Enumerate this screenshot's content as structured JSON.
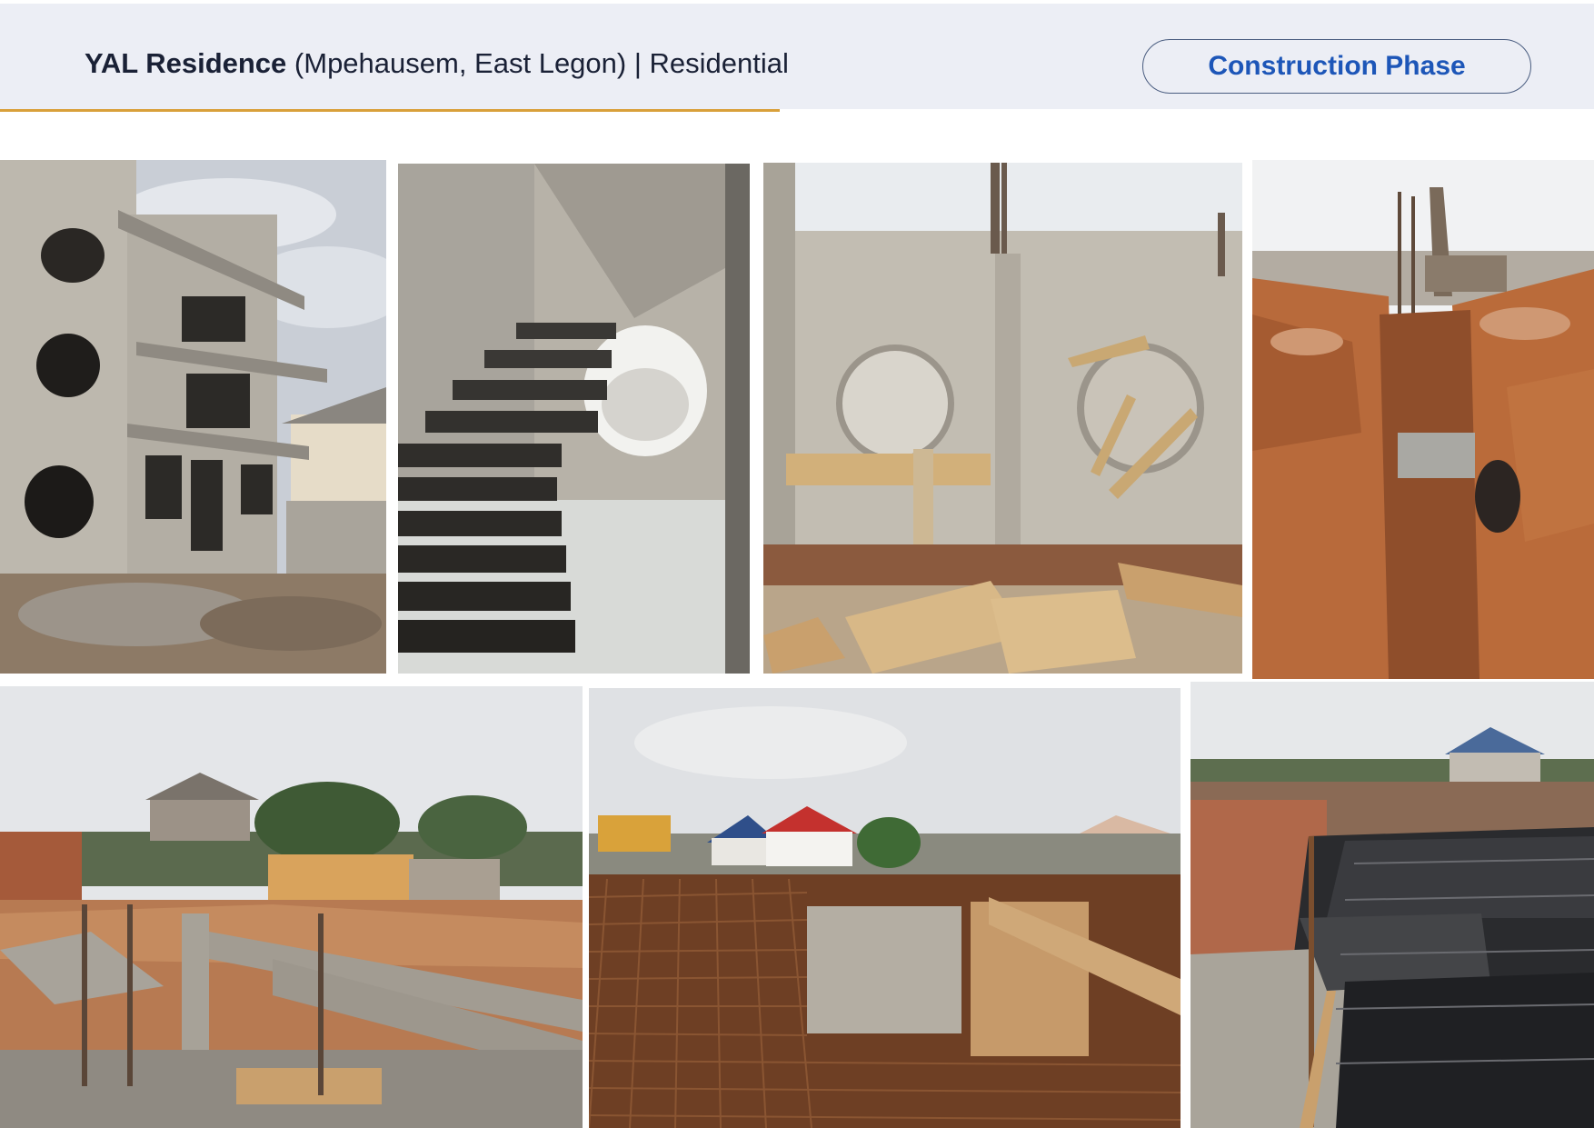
{
  "header": {
    "project_name": "YAL Residence",
    "location": "(Mpehausem, East Legon)",
    "separator": "|",
    "category": "Residential",
    "phase_badge": "Construction Phase"
  },
  "colors": {
    "header_bg": "#eceef5",
    "accent_line": "#d9a03a",
    "title_text": "#1a2136",
    "badge_text": "#1d56b8",
    "badge_border": "#4a5d80"
  },
  "gallery": {
    "photos": [
      {
        "name": "block-house-exterior"
      },
      {
        "name": "concrete-staircase"
      },
      {
        "name": "block-wall-circular-openings"
      },
      {
        "name": "foundation-trench"
      },
      {
        "name": "foundation-blockwork"
      },
      {
        "name": "rebar-grid-slab"
      },
      {
        "name": "slab-membrane-rebar"
      }
    ]
  }
}
